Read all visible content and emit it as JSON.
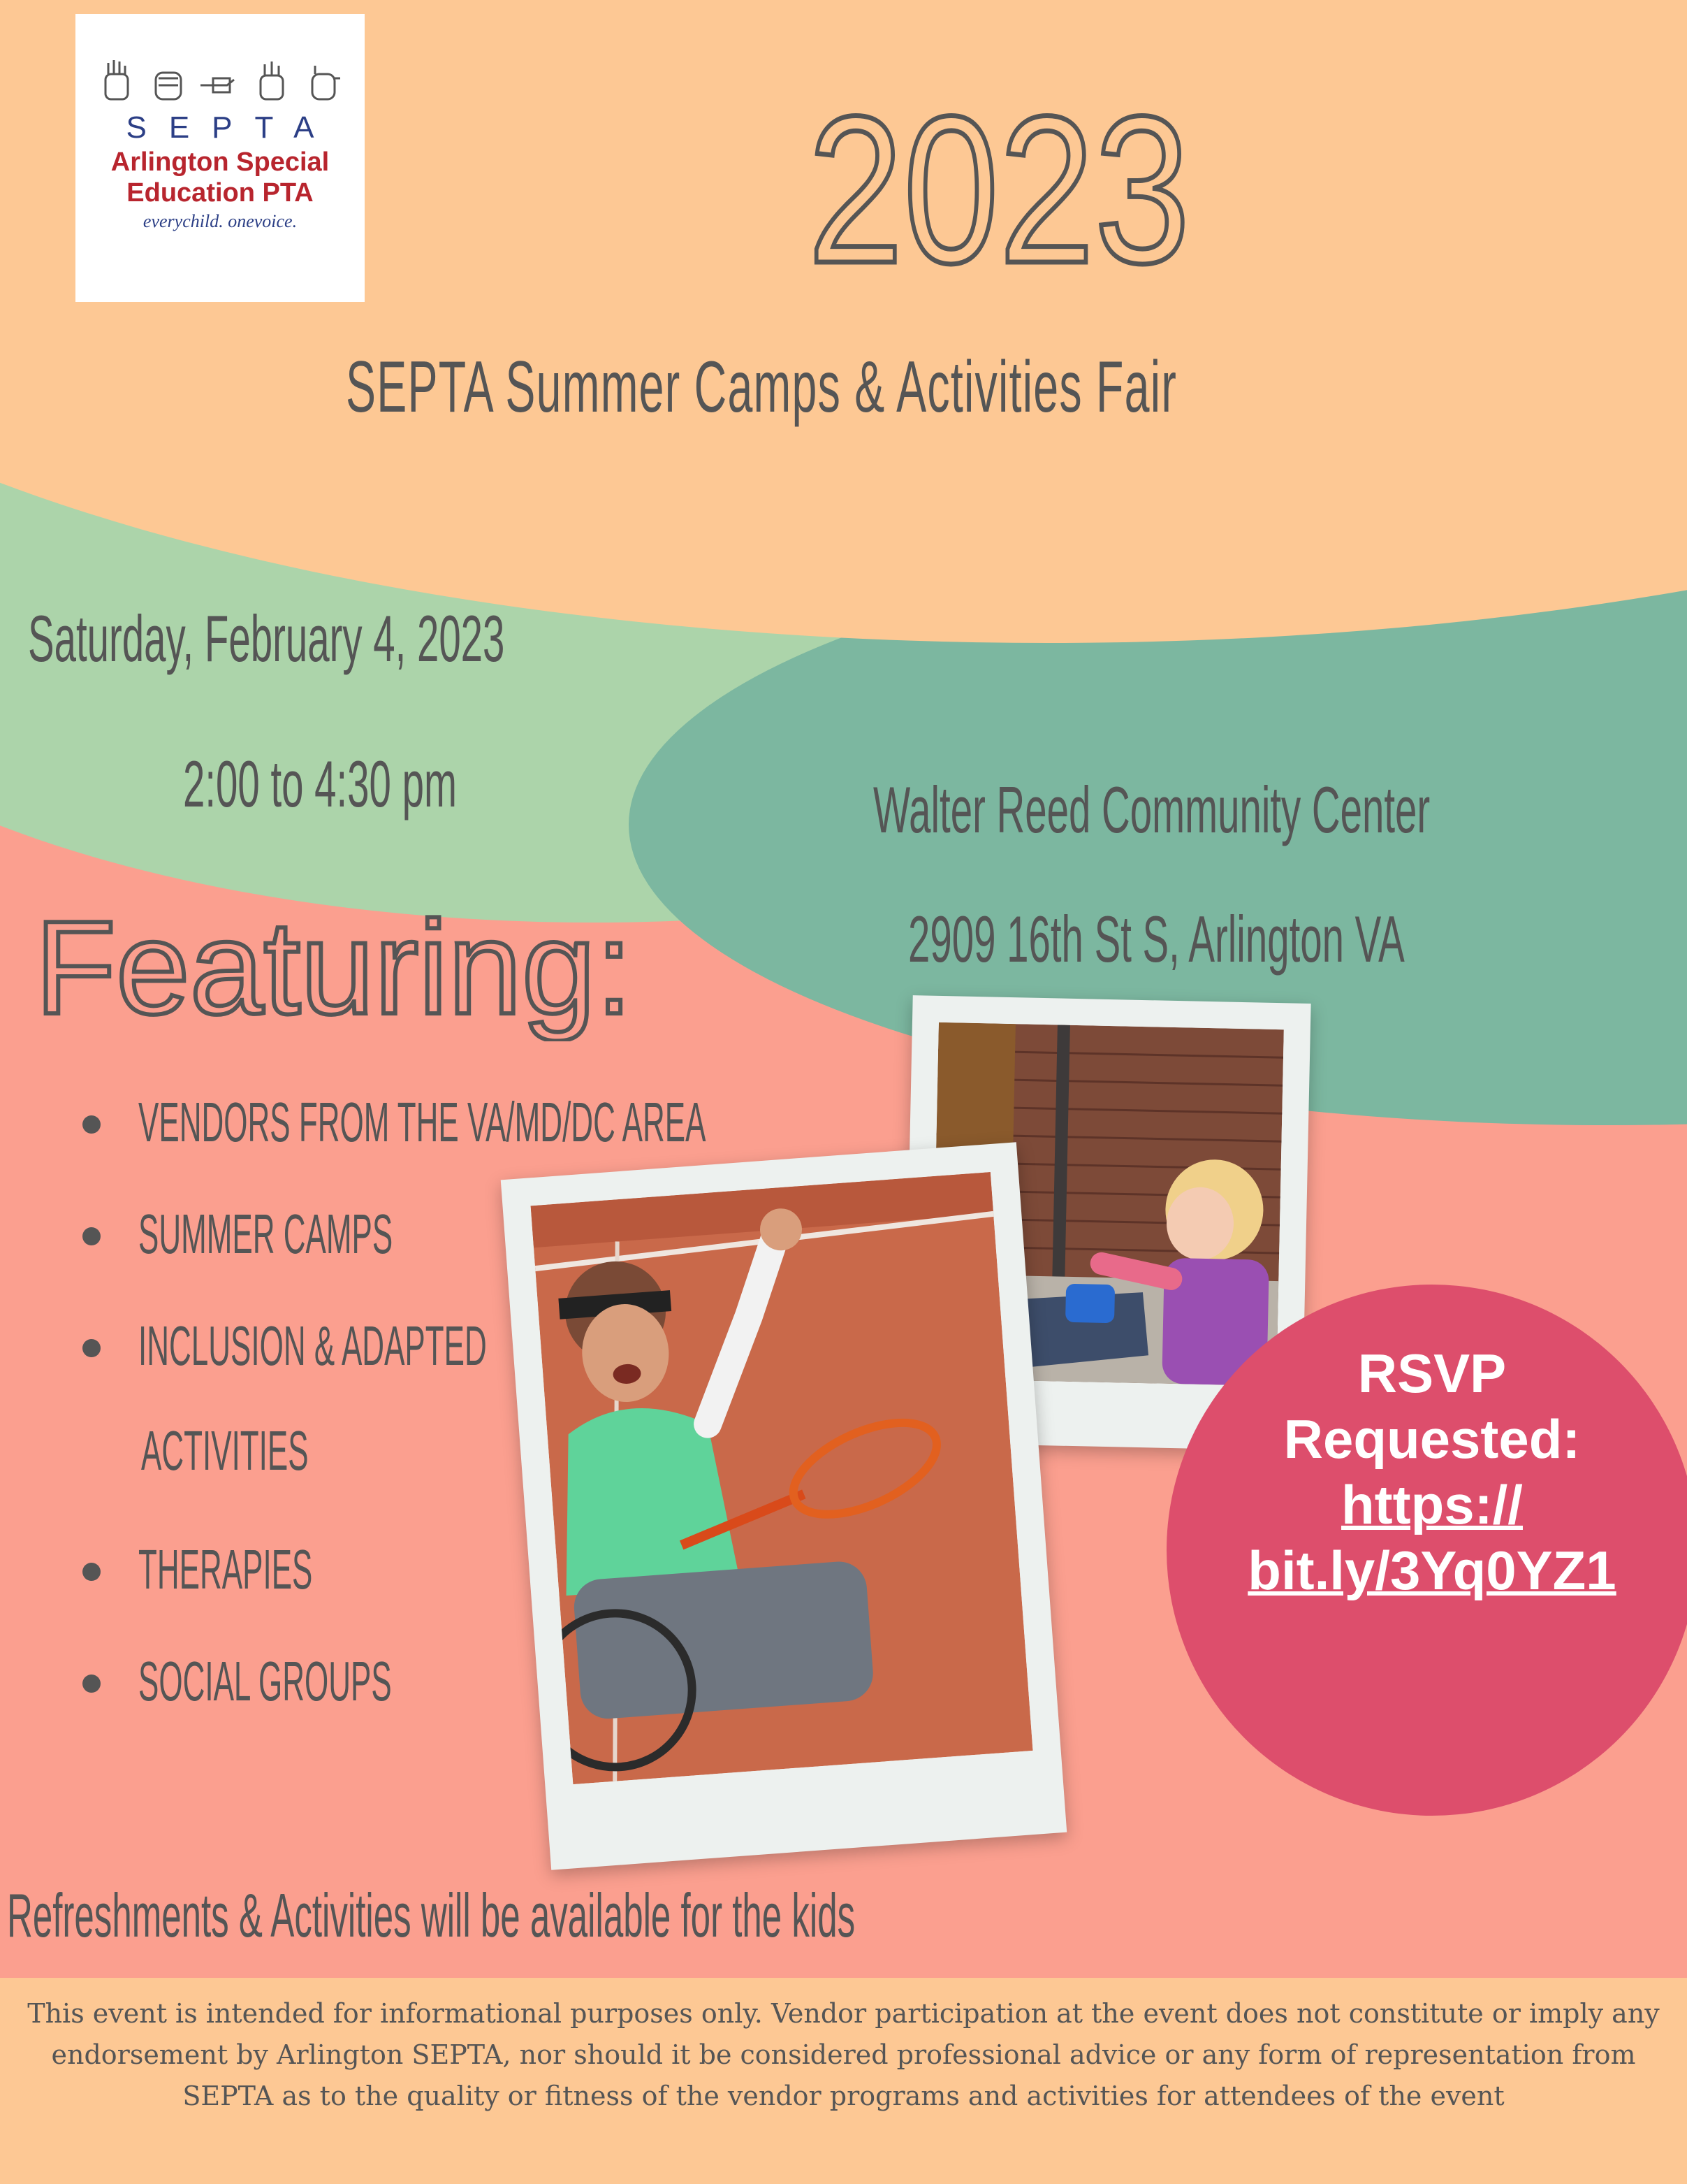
{
  "logo": {
    "letters": "SEPTA",
    "name_line1": "Arlington Special",
    "name_line2": "Education PTA",
    "tagline": "everychild. onevoice.",
    "alt": "SEPTA Arlington Special Education PTA logo"
  },
  "header": {
    "year": "2023",
    "title": "SEPTA Summer Camps & Activities Fair"
  },
  "event": {
    "date": "Saturday, February 4, 2023",
    "time": "2:00 to 4:30 pm",
    "venue": "Walter Reed Community Center",
    "address": "2909 16th St S, Arlington VA"
  },
  "featuring": {
    "heading": "Featuring:",
    "items": [
      "vendors from the VA/MD/DC area",
      "summer camps",
      "inclusion & adapted",
      "therapies",
      "social groups"
    ],
    "item_continuation": "activities"
  },
  "rsvp": {
    "line1": "RSVP",
    "line2": "Requested:",
    "link_line1": "https://",
    "link_line2": "bit.ly/3Yq0YZ1"
  },
  "refreshments": "Refreshments & Activities will be available for the kids",
  "disclaimer": "This event is intended for informational purposes only. Vendor participation at the event does not constitute or imply any endorsement by Arlington SEPTA, nor should it be considered professional advice or any form of representation from SEPTA as to the quality or fitness of the vendor programs and activities for attendees of the event",
  "colors": {
    "peach": "#fdc894",
    "light_green": "#acd4aa",
    "teal_green": "#7cb7a0",
    "salmon": "#fb9f8f",
    "rsvp_pink": "#dd4e6c",
    "text_gray": "#555555"
  }
}
